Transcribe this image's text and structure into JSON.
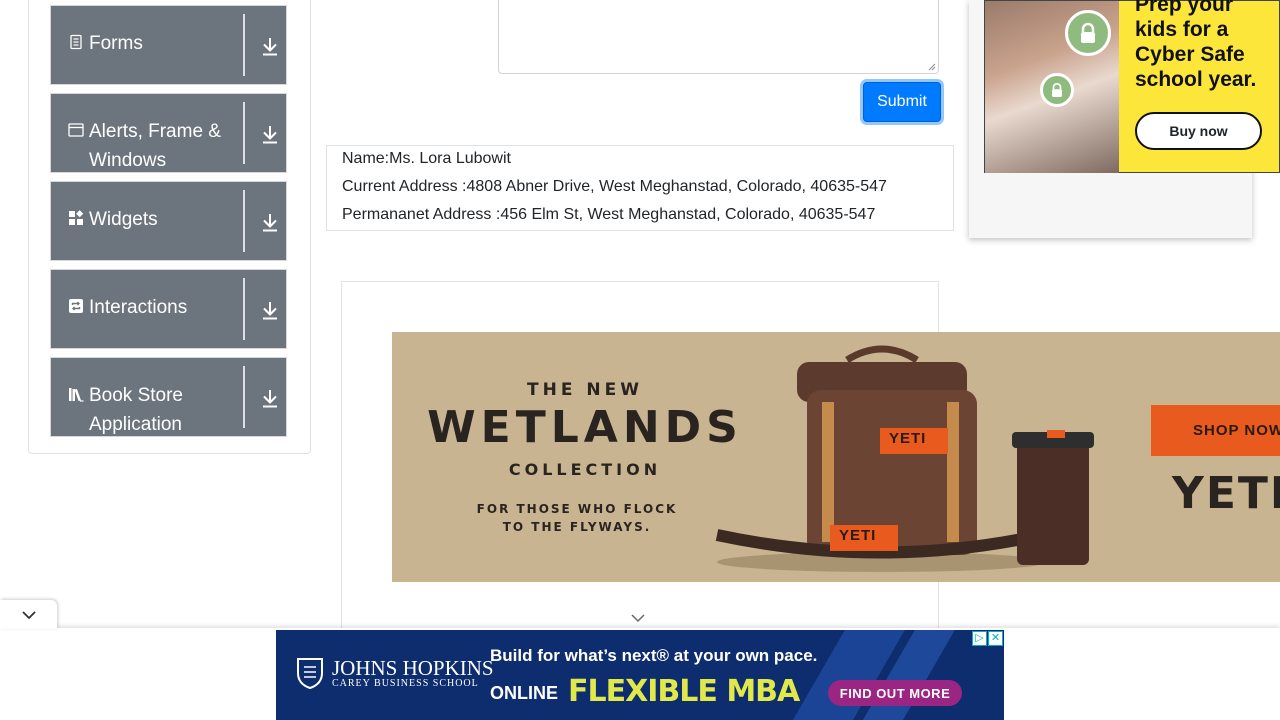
{
  "sidebar": {
    "groups": [
      {
        "label": "Forms",
        "icon": "document-icon"
      },
      {
        "label": "Alerts, Frame & Windows",
        "icon": "window-icon"
      },
      {
        "label": "Widgets",
        "icon": "widgets-icon"
      },
      {
        "label": "Interactions",
        "icon": "interactions-icon"
      },
      {
        "label": "Book Store Application",
        "icon": "books-icon"
      }
    ]
  },
  "form": {
    "submit_label": "Submit"
  },
  "output": {
    "name": "Name:Ms. Lora Lubowit",
    "current_address": "Current Address :4808 Abner Drive, West Meghanstad, Colorado, 40635-547",
    "permanent_address": "Permananet Address :456 Elm St, West Meghanstad, Colorado, 40635-547"
  },
  "ads": {
    "right": {
      "headline": "Prep your kids for a Cyber Safe school year.",
      "cta": "Buy now",
      "accent": "#fde63a"
    },
    "yeti": {
      "line1": "THE NEW",
      "line2": "WETLANDS",
      "line3": "COLLECTION",
      "tagline1": "FOR THOSE WHO FLOCK",
      "tagline2": "TO THE FLYWAYS.",
      "cta": "SHOP NOW",
      "brand": "YETI",
      "bag_label": "YETI",
      "accent": "#e85a1d"
    },
    "bottom": {
      "brand_name": "JOHNS HOPKINS",
      "brand_sub": "CAREY BUSINESS SCHOOL",
      "headline": "Build for what’s next® at your own pace.",
      "online": "ONLINE",
      "program": "FLEXIBLE MBA",
      "cta": "FIND OUT MORE",
      "accent": "#9b2583"
    }
  },
  "colors": {
    "sidebar_group_bg": "#6c757d",
    "primary": "#007bff"
  }
}
